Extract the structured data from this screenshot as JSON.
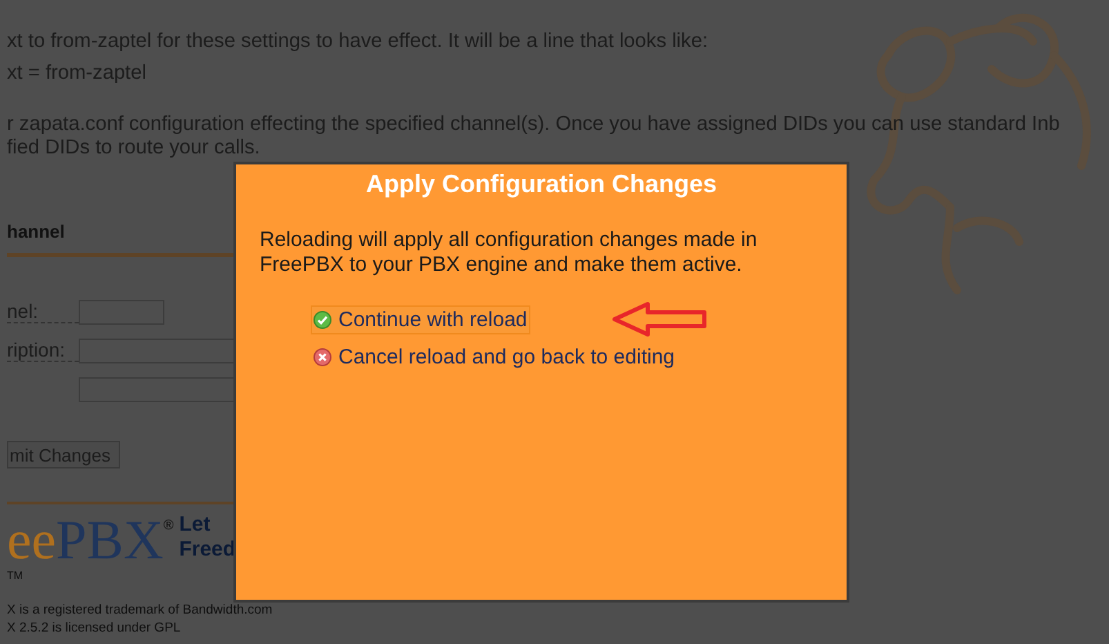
{
  "background_page": {
    "paragraphs": [
      {
        "lines": [
          "xt to from-zaptel for these settings to have effect. It will be a line that looks like:"
        ]
      },
      {
        "lines": [
          "xt = from-zaptel"
        ]
      },
      {
        "lines": [
          "r zapata.conf configuration effecting the specified channel(s). Once you have assigned DIDs you can use standard Inb",
          "fied DIDs to route your calls."
        ]
      }
    ],
    "section_title": "hannel",
    "form_fields": [
      {
        "kind": "labeled",
        "label": "nel:"
      },
      {
        "kind": "labeled",
        "label": "ription:"
      },
      {
        "kind": "unlabeled"
      }
    ],
    "submit_button": "mit Changes",
    "logo": {
      "brand_first": "ee",
      "brand_second": "PBX",
      "registered": "®",
      "tagline": [
        "Let",
        "Freed"
      ],
      "trademark": "TM"
    },
    "footer": [
      "X is a registered trademark of Bandwidth.com",
      "X 2.5.2 is licensed under GPL"
    ]
  },
  "dialog": {
    "title": "Apply Configuration Changes",
    "message": "Reloading will apply all configuration changes made in FreePBX to your PBX engine and make them active.",
    "options": [
      {
        "label": "Continue with reload",
        "kind": "confirm",
        "selected": true
      },
      {
        "label": "Cancel reload and go back to editing",
        "kind": "cancel",
        "selected": false
      }
    ]
  }
}
